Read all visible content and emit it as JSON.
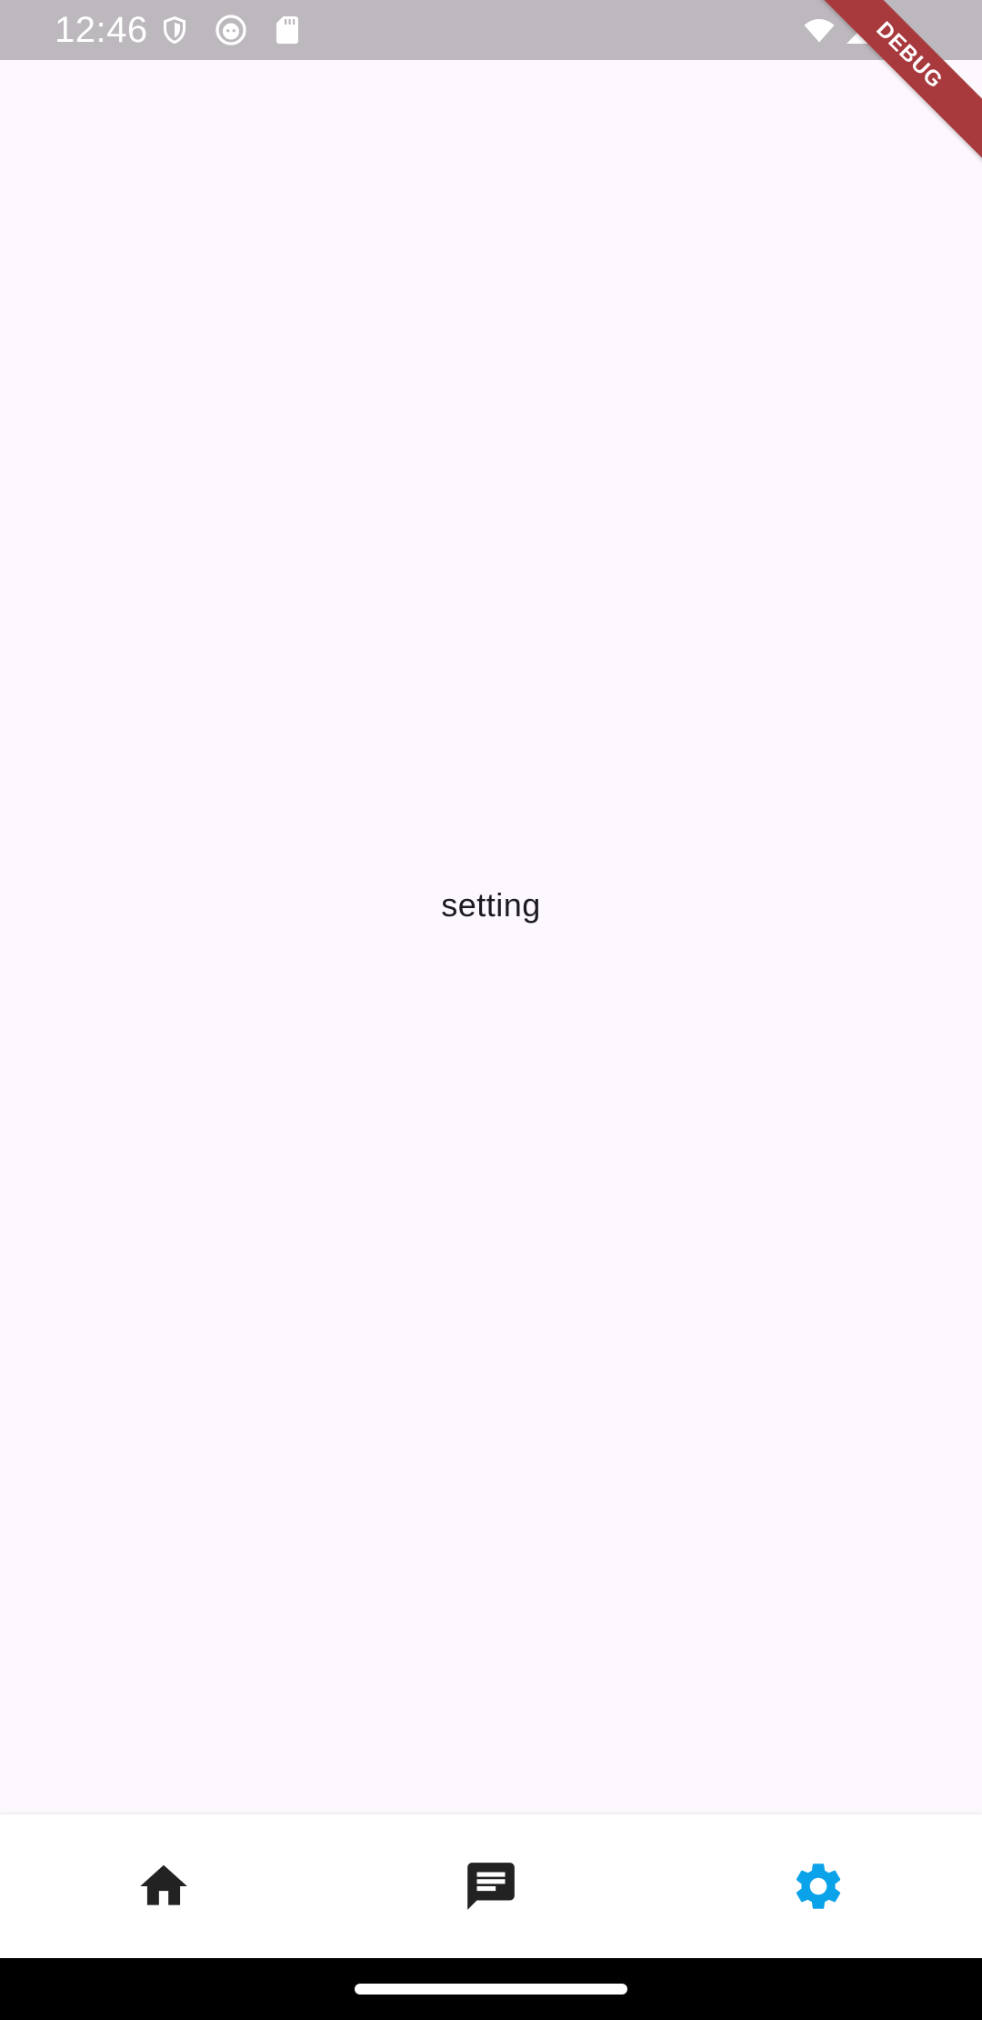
{
  "status_bar": {
    "time": "12:46",
    "icons": [
      "shield-icon",
      "android-icon",
      "sd-card-icon",
      "wifi-icon",
      "cellular-signal-icon"
    ]
  },
  "debug_banner": {
    "label": "DEBUG"
  },
  "main": {
    "label": "setting"
  },
  "bottom_nav": {
    "items": [
      {
        "icon": "home-icon",
        "selected": false
      },
      {
        "icon": "chat-icon",
        "selected": false
      },
      {
        "icon": "settings-icon",
        "selected": true
      }
    ]
  },
  "colors": {
    "status_bar": "#bdb8bd",
    "background": "#fdf7fe",
    "nav_active": "#0aa2e8",
    "nav_inactive": "#222222",
    "debug_banner": "#a83a3e",
    "system_nav": "#000000"
  }
}
